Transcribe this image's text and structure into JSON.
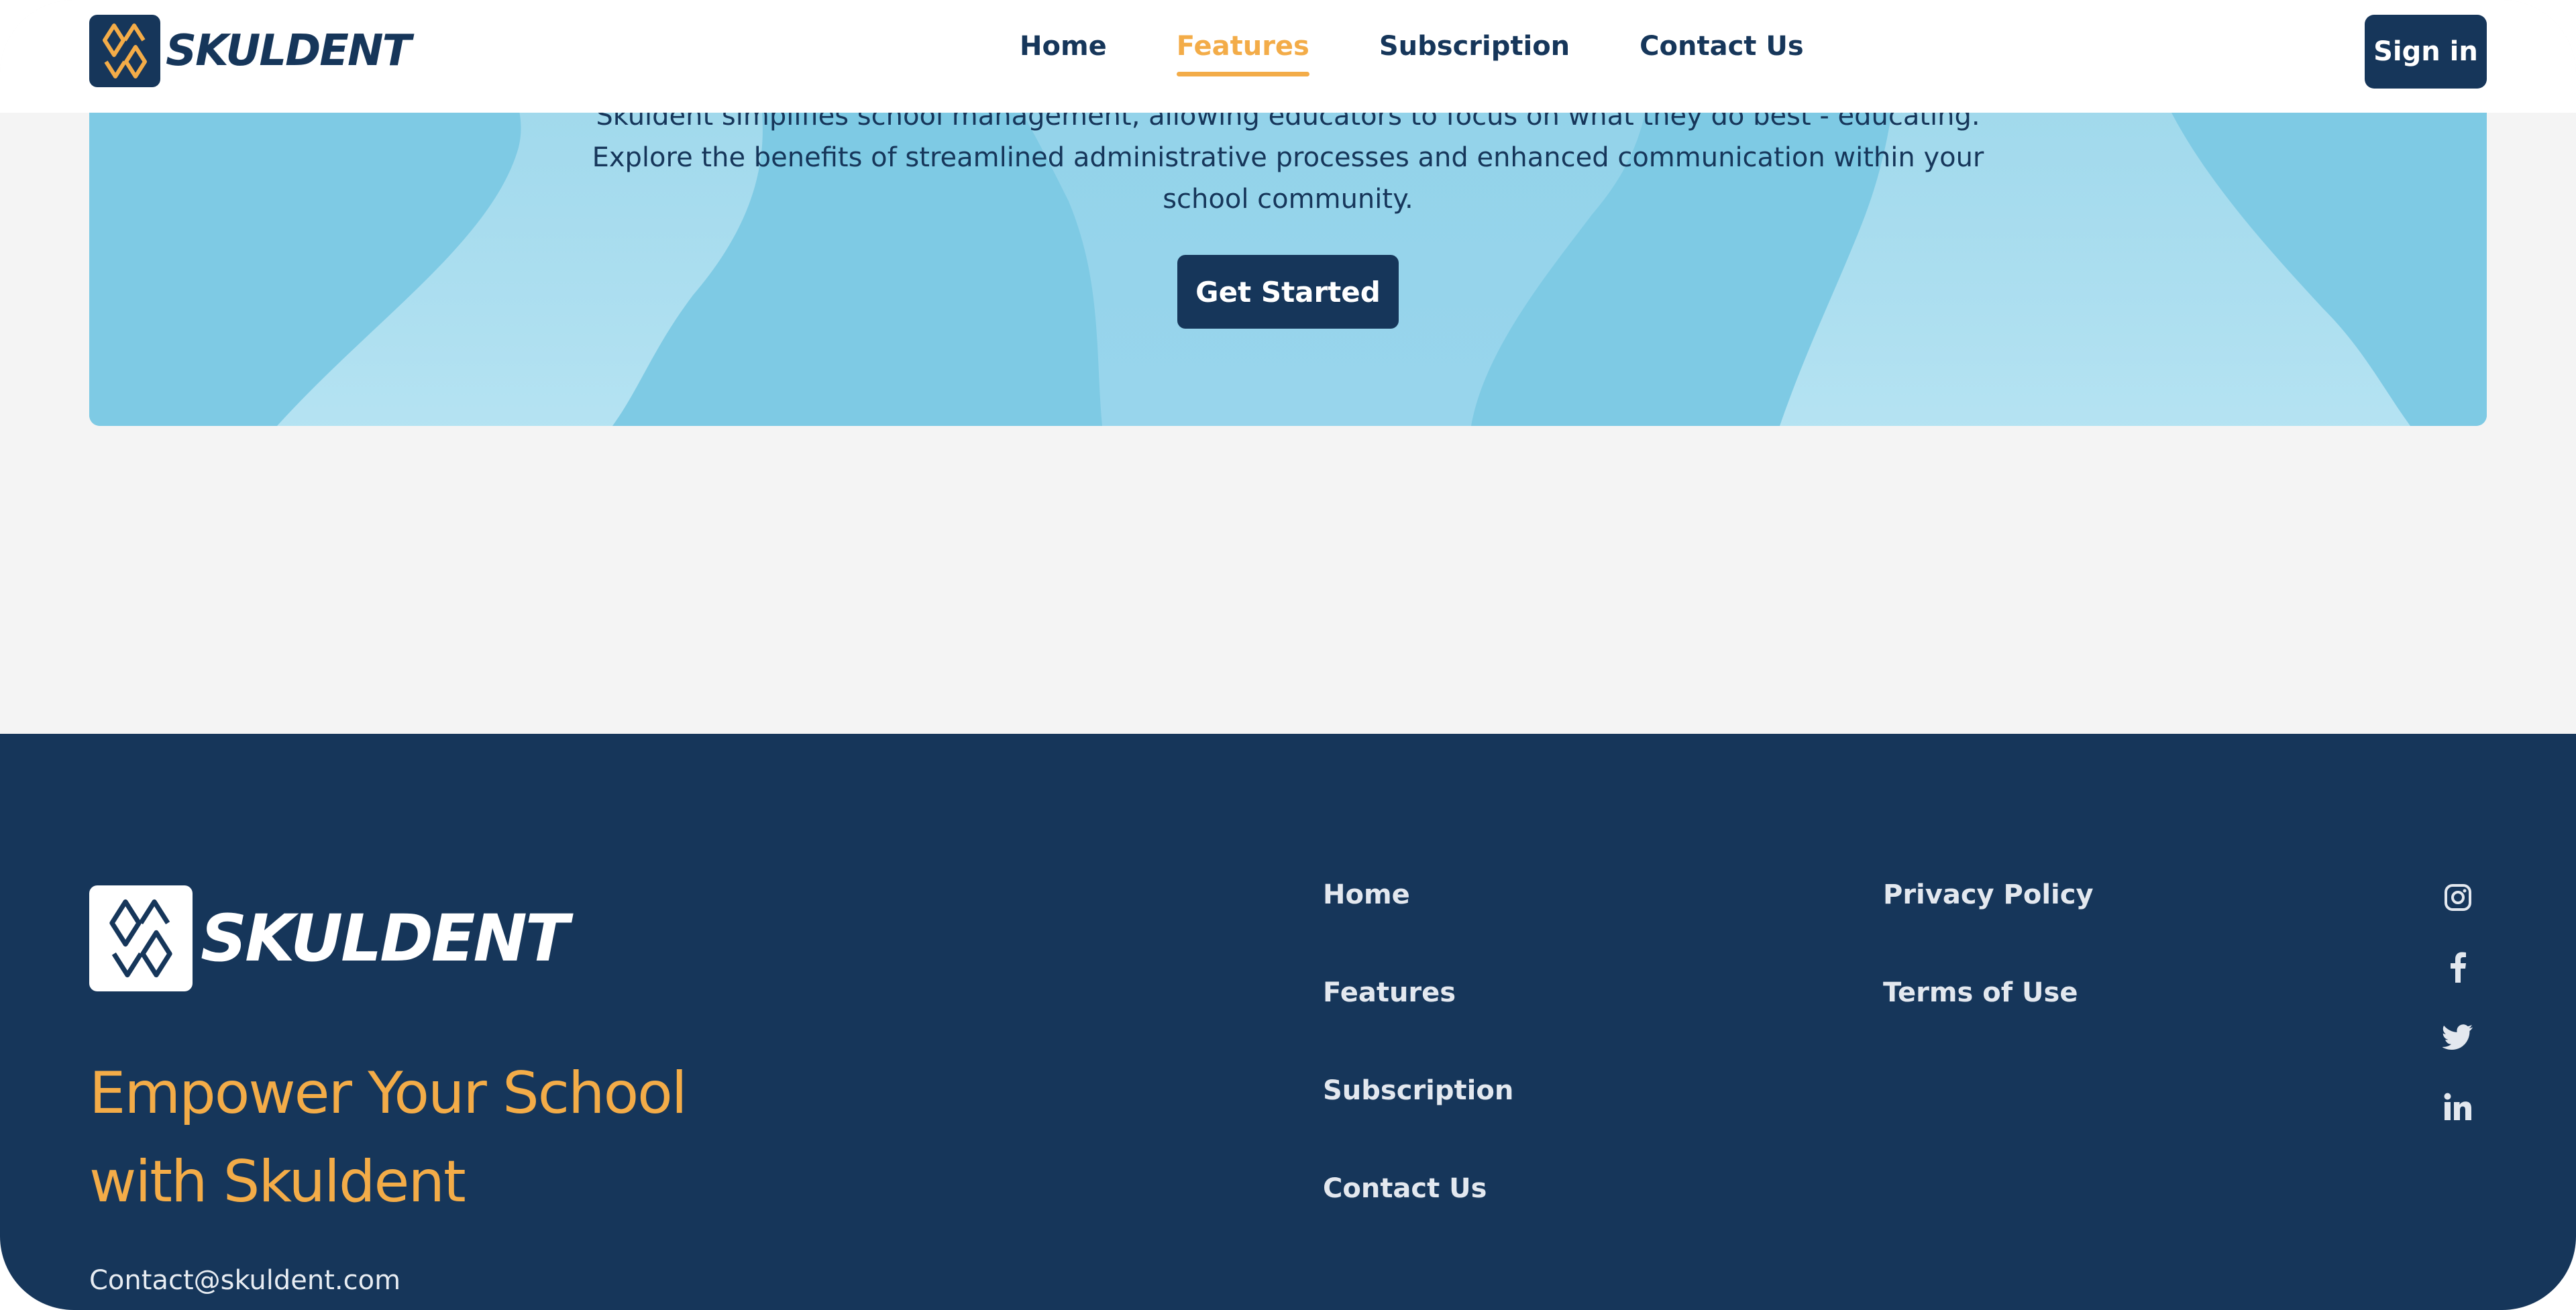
{
  "brand": {
    "name": "SKULDENT",
    "logo_icon": "skuldent-logo-icon"
  },
  "colors": {
    "navy": "#16365a",
    "accent": "#f3ac48",
    "hero_blue": "#7ecae4",
    "page_bg": "#f4f4f4"
  },
  "nav": {
    "items": [
      {
        "label": "Home",
        "active": false
      },
      {
        "label": "Features",
        "active": true
      },
      {
        "label": "Subscription",
        "active": false
      },
      {
        "label": "Contact Us",
        "active": false
      }
    ],
    "signin_label": "Sign in"
  },
  "hero": {
    "lines": [
      "Skuldent simplifies school management, allowing educators to focus on what they do best - educating.",
      "Explore the benefits of streamlined administrative processes and enhanced communication within your",
      "school community."
    ],
    "cta_label": "Get Started"
  },
  "footer": {
    "brand_name": "SKULDENT",
    "tagline_lines": [
      "Empower Your School",
      "with Skuldent"
    ],
    "email": "Contact@skuldent.com",
    "nav_links": [
      "Home",
      "Features",
      "Subscription",
      "Contact Us"
    ],
    "legal_links": [
      "Privacy Policy",
      "Terms of Use"
    ],
    "socials": [
      "instagram-icon",
      "facebook-icon",
      "twitter-icon",
      "linkedin-icon"
    ]
  }
}
